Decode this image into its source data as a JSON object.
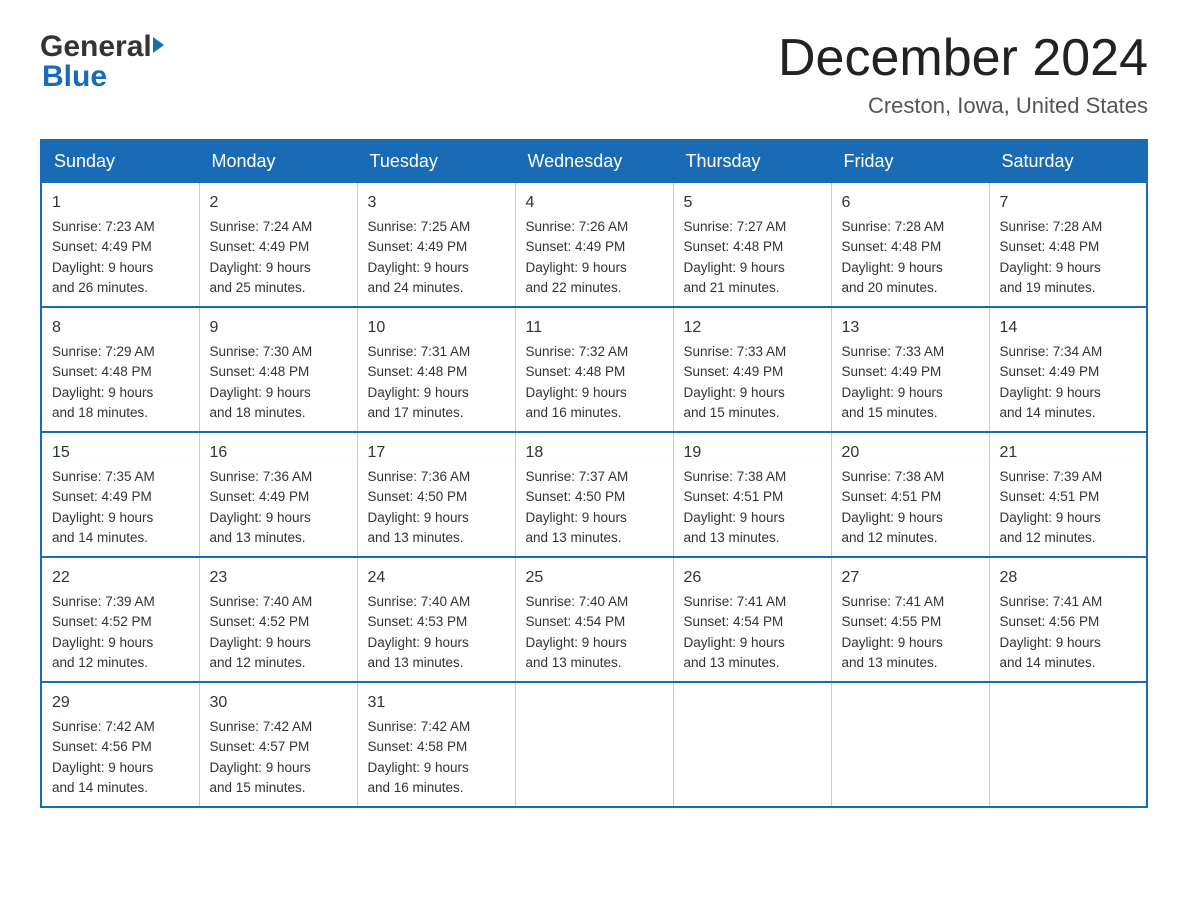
{
  "header": {
    "logo_text1": "General",
    "logo_text2": "Blue",
    "month_title": "December 2024",
    "location": "Creston, Iowa, United States"
  },
  "days_of_week": [
    "Sunday",
    "Monday",
    "Tuesday",
    "Wednesday",
    "Thursday",
    "Friday",
    "Saturday"
  ],
  "weeks": [
    [
      {
        "day": "1",
        "sunrise": "7:23 AM",
        "sunset": "4:49 PM",
        "daylight": "9 hours and 26 minutes."
      },
      {
        "day": "2",
        "sunrise": "7:24 AM",
        "sunset": "4:49 PM",
        "daylight": "9 hours and 25 minutes."
      },
      {
        "day": "3",
        "sunrise": "7:25 AM",
        "sunset": "4:49 PM",
        "daylight": "9 hours and 24 minutes."
      },
      {
        "day": "4",
        "sunrise": "7:26 AM",
        "sunset": "4:49 PM",
        "daylight": "9 hours and 22 minutes."
      },
      {
        "day": "5",
        "sunrise": "7:27 AM",
        "sunset": "4:48 PM",
        "daylight": "9 hours and 21 minutes."
      },
      {
        "day": "6",
        "sunrise": "7:28 AM",
        "sunset": "4:48 PM",
        "daylight": "9 hours and 20 minutes."
      },
      {
        "day": "7",
        "sunrise": "7:28 AM",
        "sunset": "4:48 PM",
        "daylight": "9 hours and 19 minutes."
      }
    ],
    [
      {
        "day": "8",
        "sunrise": "7:29 AM",
        "sunset": "4:48 PM",
        "daylight": "9 hours and 18 minutes."
      },
      {
        "day": "9",
        "sunrise": "7:30 AM",
        "sunset": "4:48 PM",
        "daylight": "9 hours and 18 minutes."
      },
      {
        "day": "10",
        "sunrise": "7:31 AM",
        "sunset": "4:48 PM",
        "daylight": "9 hours and 17 minutes."
      },
      {
        "day": "11",
        "sunrise": "7:32 AM",
        "sunset": "4:48 PM",
        "daylight": "9 hours and 16 minutes."
      },
      {
        "day": "12",
        "sunrise": "7:33 AM",
        "sunset": "4:49 PM",
        "daylight": "9 hours and 15 minutes."
      },
      {
        "day": "13",
        "sunrise": "7:33 AM",
        "sunset": "4:49 PM",
        "daylight": "9 hours and 15 minutes."
      },
      {
        "day": "14",
        "sunrise": "7:34 AM",
        "sunset": "4:49 PM",
        "daylight": "9 hours and 14 minutes."
      }
    ],
    [
      {
        "day": "15",
        "sunrise": "7:35 AM",
        "sunset": "4:49 PM",
        "daylight": "9 hours and 14 minutes."
      },
      {
        "day": "16",
        "sunrise": "7:36 AM",
        "sunset": "4:49 PM",
        "daylight": "9 hours and 13 minutes."
      },
      {
        "day": "17",
        "sunrise": "7:36 AM",
        "sunset": "4:50 PM",
        "daylight": "9 hours and 13 minutes."
      },
      {
        "day": "18",
        "sunrise": "7:37 AM",
        "sunset": "4:50 PM",
        "daylight": "9 hours and 13 minutes."
      },
      {
        "day": "19",
        "sunrise": "7:38 AM",
        "sunset": "4:51 PM",
        "daylight": "9 hours and 13 minutes."
      },
      {
        "day": "20",
        "sunrise": "7:38 AM",
        "sunset": "4:51 PM",
        "daylight": "9 hours and 12 minutes."
      },
      {
        "day": "21",
        "sunrise": "7:39 AM",
        "sunset": "4:51 PM",
        "daylight": "9 hours and 12 minutes."
      }
    ],
    [
      {
        "day": "22",
        "sunrise": "7:39 AM",
        "sunset": "4:52 PM",
        "daylight": "9 hours and 12 minutes."
      },
      {
        "day": "23",
        "sunrise": "7:40 AM",
        "sunset": "4:52 PM",
        "daylight": "9 hours and 12 minutes."
      },
      {
        "day": "24",
        "sunrise": "7:40 AM",
        "sunset": "4:53 PM",
        "daylight": "9 hours and 13 minutes."
      },
      {
        "day": "25",
        "sunrise": "7:40 AM",
        "sunset": "4:54 PM",
        "daylight": "9 hours and 13 minutes."
      },
      {
        "day": "26",
        "sunrise": "7:41 AM",
        "sunset": "4:54 PM",
        "daylight": "9 hours and 13 minutes."
      },
      {
        "day": "27",
        "sunrise": "7:41 AM",
        "sunset": "4:55 PM",
        "daylight": "9 hours and 13 minutes."
      },
      {
        "day": "28",
        "sunrise": "7:41 AM",
        "sunset": "4:56 PM",
        "daylight": "9 hours and 14 minutes."
      }
    ],
    [
      {
        "day": "29",
        "sunrise": "7:42 AM",
        "sunset": "4:56 PM",
        "daylight": "9 hours and 14 minutes."
      },
      {
        "day": "30",
        "sunrise": "7:42 AM",
        "sunset": "4:57 PM",
        "daylight": "9 hours and 15 minutes."
      },
      {
        "day": "31",
        "sunrise": "7:42 AM",
        "sunset": "4:58 PM",
        "daylight": "9 hours and 16 minutes."
      },
      null,
      null,
      null,
      null
    ]
  ],
  "labels": {
    "sunrise": "Sunrise:",
    "sunset": "Sunset:",
    "daylight": "Daylight:"
  }
}
